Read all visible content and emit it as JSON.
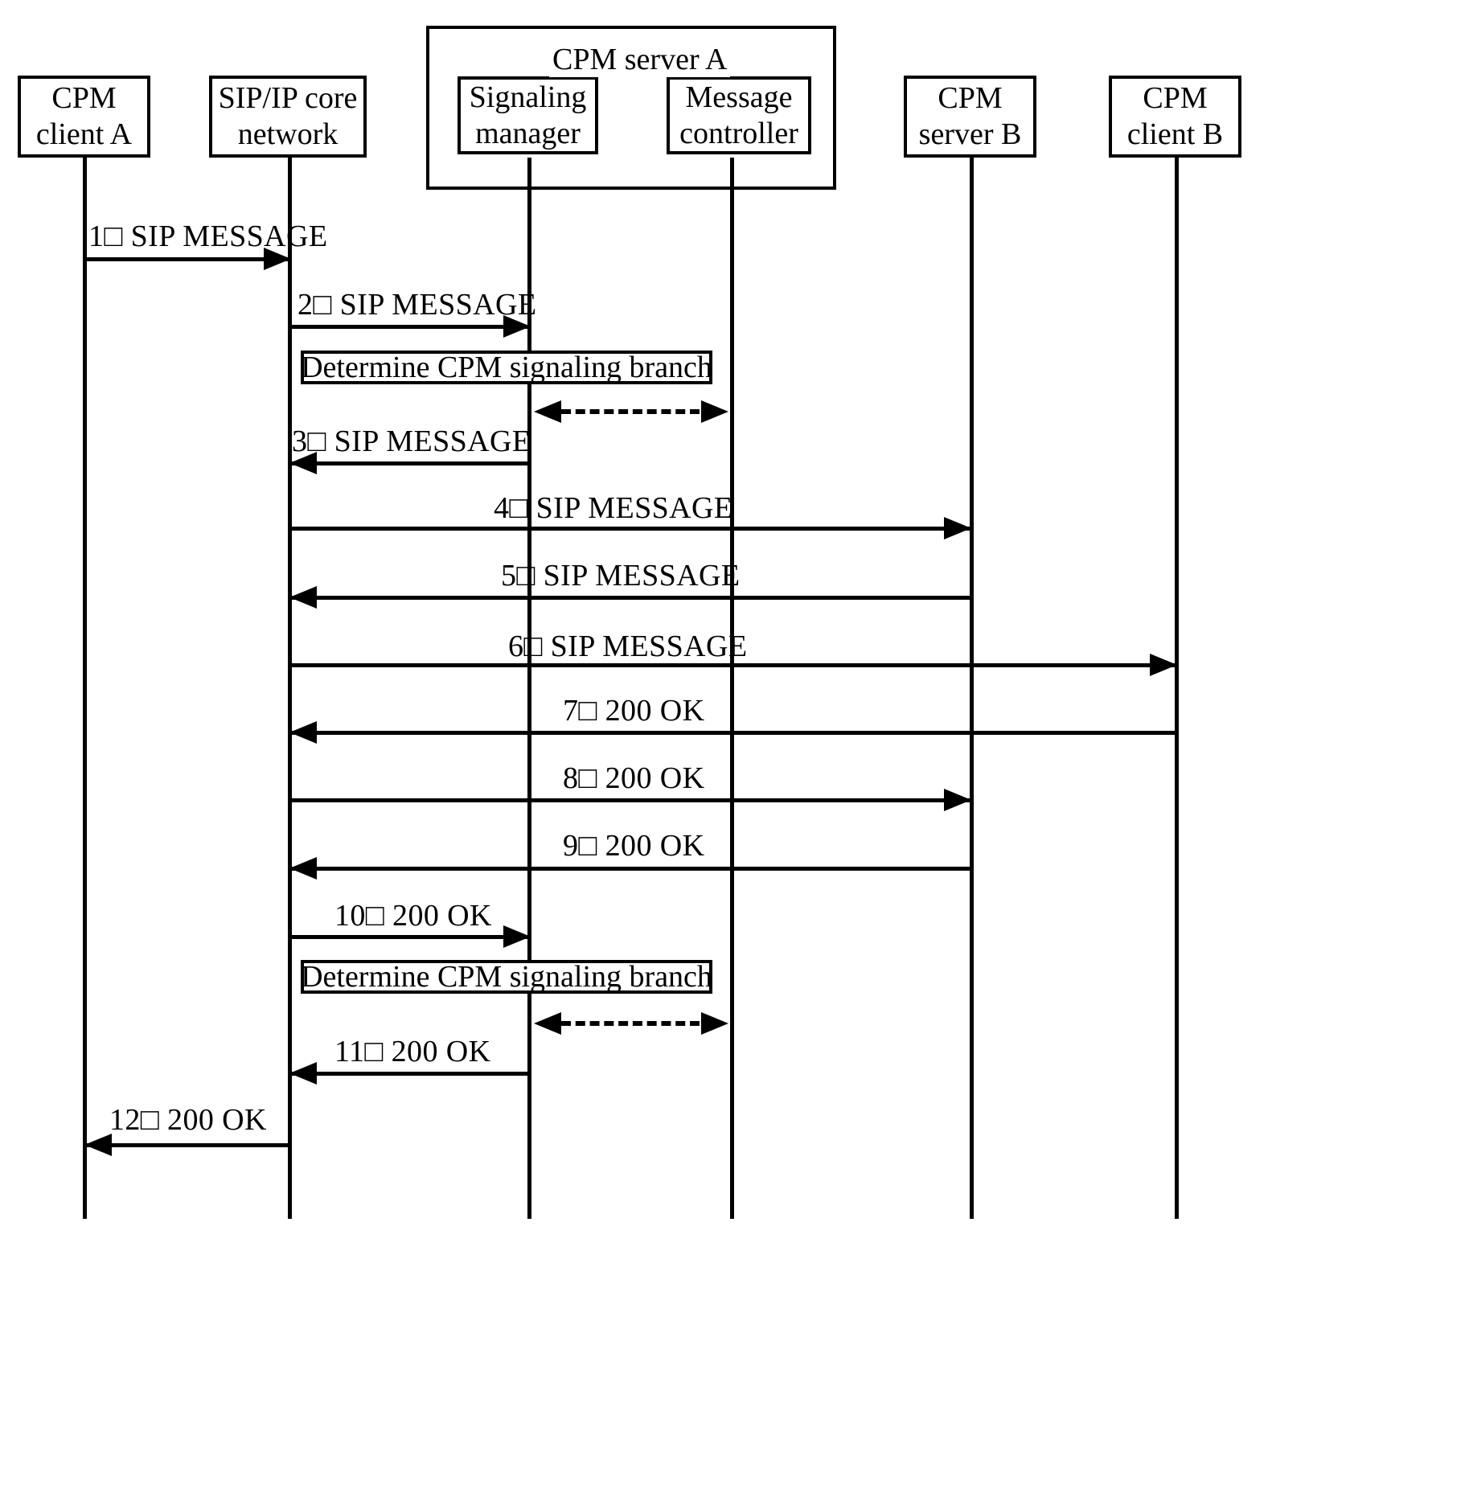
{
  "diagram": {
    "type": "sequence-diagram",
    "title": "CPM SIP MESSAGE signaling flow"
  },
  "participants": [
    {
      "id": "cpm-client-a",
      "line1": "CPM",
      "line2": "client A"
    },
    {
      "id": "sip-ip-core-network",
      "line1": "SIP/IP core",
      "line2": "network"
    },
    {
      "id": "signaling-manager",
      "line1": "Signaling",
      "line2": "manager"
    },
    {
      "id": "message-controller",
      "line1": "Message",
      "line2": "controller"
    },
    {
      "id": "cpm-server-b",
      "line1": "CPM",
      "line2": "server B"
    },
    {
      "id": "cpm-client-b",
      "line1": "CPM",
      "line2": "client B"
    }
  ],
  "group": {
    "id": "cpm-server-a",
    "title": "CPM server A"
  },
  "messages": [
    {
      "num": "1␣",
      "label": "1\u0000  SIP MESSAGE",
      "text": "SIP MESSAGE",
      "from": "cpm-client-a",
      "to": "sip-ip-core-network",
      "dir": "right",
      "style": "solid"
    },
    {
      "num": "2",
      "label": "2\u0000  SIP MESSAGE",
      "text": "SIP MESSAGE",
      "from": "sip-ip-core-network",
      "to": "signaling-manager",
      "dir": "right",
      "style": "solid"
    },
    {
      "num": "3",
      "label": "3\u0000  SIP MESSAGE",
      "text": "SIP MESSAGE",
      "from": "signaling-manager",
      "to": "sip-ip-core-network",
      "dir": "left",
      "style": "solid"
    },
    {
      "num": "4",
      "label": "4\u0000  SIP MESSAGE",
      "text": "SIP MESSAGE",
      "from": "sip-ip-core-network",
      "to": "cpm-server-b",
      "dir": "right",
      "style": "solid"
    },
    {
      "num": "5",
      "label": "5\u0000  SIP MESSAGE",
      "text": "SIP MESSAGE",
      "from": "cpm-server-b",
      "to": "sip-ip-core-network",
      "dir": "left",
      "style": "solid"
    },
    {
      "num": "6",
      "label": "6\u0000  SIP MESSAGE",
      "text": "SIP MESSAGE",
      "from": "sip-ip-core-network",
      "to": "cpm-client-b",
      "dir": "right",
      "style": "solid"
    },
    {
      "num": "7",
      "label": "7\u0000  200 OK",
      "text": "200 OK",
      "from": "cpm-client-b",
      "to": "sip-ip-core-network",
      "dir": "left",
      "style": "solid"
    },
    {
      "num": "8",
      "label": "8\u0000  200 OK",
      "text": "200 OK",
      "from": "sip-ip-core-network",
      "to": "cpm-server-b",
      "dir": "right",
      "style": "solid"
    },
    {
      "num": "9",
      "label": "9\u0000  200 OK",
      "text": "200 OK",
      "from": "cpm-server-b",
      "to": "sip-ip-core-network",
      "dir": "left",
      "style": "solid"
    },
    {
      "num": "10",
      "label": "10\u0000  200 OK",
      "text": "200 OK",
      "from": "sip-ip-core-network",
      "to": "signaling-manager",
      "dir": "right",
      "style": "solid"
    },
    {
      "num": "11",
      "label": "11\u0000  200 OK",
      "text": "200 OK",
      "from": "signaling-manager",
      "to": "sip-ip-core-network",
      "dir": "left",
      "style": "solid"
    },
    {
      "num": "12",
      "label": "12\u0000  200 OK",
      "text": "200 OK",
      "from": "sip-ip-core-network",
      "to": "cpm-client-a",
      "dir": "left",
      "style": "solid"
    }
  ],
  "labels": {
    "m1": "1□   SIP MESSAGE",
    "m2": "2□   SIP MESSAGE",
    "m3": "3□   SIP MESSAGE",
    "m4": "4□   SIP MESSAGE",
    "m5": "5□   SIP MESSAGE",
    "m6": "6□   SIP MESSAGE",
    "m7": "7□   200 OK",
    "m8": "8□   200 OK",
    "m9": "9□   200 OK",
    "m10": "10□   200 OK",
    "m11": "11□   200 OK",
    "m12": "12□   200 OK"
  },
  "notes": [
    {
      "id": "determine-branch-1",
      "text": "Determine CPM signaling branch"
    },
    {
      "id": "determine-branch-2",
      "text": "Determine CPM signaling branch"
    }
  ],
  "internal_exchanges": [
    {
      "id": "internal-dashed-1",
      "from": "signaling-manager",
      "to": "message-controller",
      "style": "dashed",
      "dir": "both"
    },
    {
      "id": "internal-dashed-2",
      "from": "signaling-manager",
      "to": "message-controller",
      "style": "dashed",
      "dir": "both"
    }
  ],
  "colors": {
    "stroke": "#000000",
    "background": "#ffffff"
  }
}
